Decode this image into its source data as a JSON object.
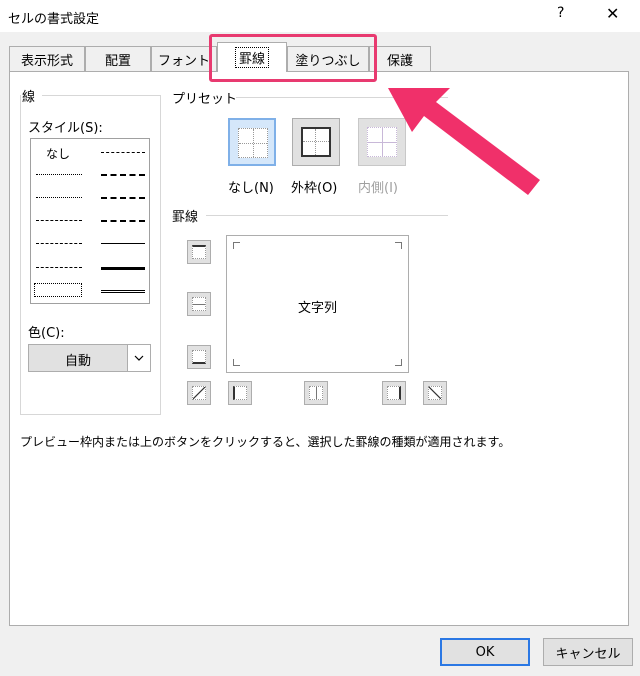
{
  "window": {
    "title": "セルの書式設定",
    "help_label": "?",
    "close_label": "✕"
  },
  "tabs": [
    {
      "label": "表示形式"
    },
    {
      "label": "配置"
    },
    {
      "label": "フォント"
    },
    {
      "label": "罫線"
    },
    {
      "label": "塗りつぶし"
    },
    {
      "label": "保護"
    }
  ],
  "line_group": {
    "title": "線",
    "style_label": "スタイル(S):",
    "none_label": "なし",
    "color_label": "色(C):",
    "color_value": "自動"
  },
  "preset_group": {
    "title": "プリセット",
    "items": [
      {
        "label": "なし(N)"
      },
      {
        "label": "外枠(O)"
      },
      {
        "label": "内側(I)"
      }
    ]
  },
  "border_group": {
    "title": "罫線",
    "preview_text": "文字列"
  },
  "hint": "プレビュー枠内または上のボタンをクリックすると、選択した罫線の種類が適用されます。",
  "buttons": {
    "ok": "OK",
    "cancel": "キャンセル"
  },
  "colors": {
    "highlight": "#e83a70",
    "arrow": "#f0306a",
    "selected_border": "#2b78e4"
  },
  "icons": {
    "help": "help-icon",
    "close": "close-icon",
    "dropdown": "chevron-down-icon",
    "arrow": "pointer-arrow-icon"
  }
}
